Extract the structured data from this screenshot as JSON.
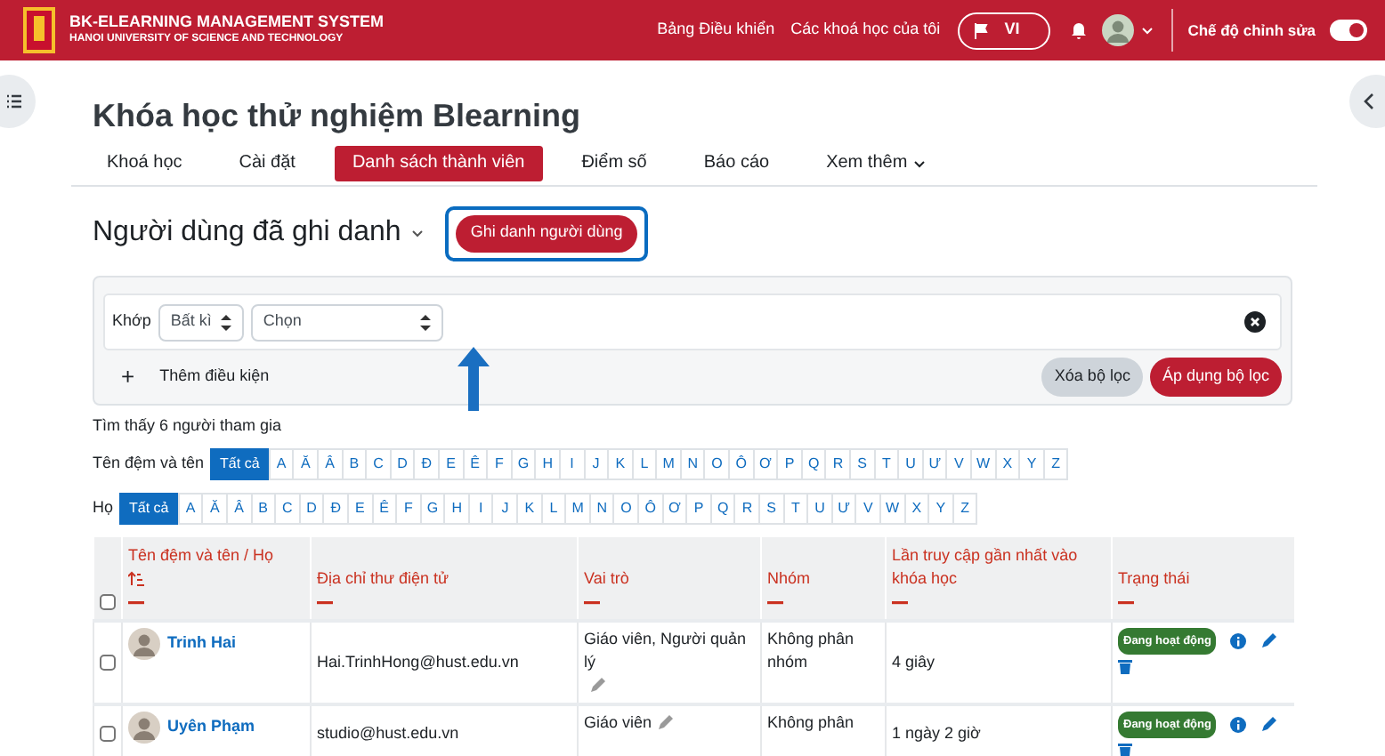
{
  "navbar": {
    "brand_title": "BK-ELEARNING MANAGEMENT SYSTEM",
    "brand_subtitle": "HANOI UNIVERSITY OF SCIENCE AND TECHNOLOGY",
    "links": [
      "Bảng Điều khiển",
      "Các khoá học của tôi"
    ],
    "language": "VI",
    "edit_mode_label": "Chế độ chỉnh sửa",
    "edit_mode_on": true
  },
  "course_title": "Khóa học thử nghiệm Blearning",
  "tabs": [
    {
      "label": "Khoá học",
      "selected": false,
      "has_menu": false
    },
    {
      "label": "Cài đặt",
      "selected": false,
      "has_menu": false
    },
    {
      "label": "Danh sách thành viên",
      "selected": true,
      "has_menu": false
    },
    {
      "label": "Điểm số",
      "selected": false,
      "has_menu": false
    },
    {
      "label": "Báo cáo",
      "selected": false,
      "has_menu": false
    },
    {
      "label": "Xem thêm",
      "selected": false,
      "has_menu": true
    }
  ],
  "page_heading": "Người dùng đã ghi danh",
  "enrol_button": "Ghi danh người dùng",
  "filter": {
    "match_label": "Khớp",
    "match_value": "Bất kì",
    "type_value": "Chọn",
    "add_symbol": "+",
    "add_condition": "Thêm điều kiện",
    "clear_button": "Xóa bộ lọc",
    "apply_button": "Áp dụng bộ lọc"
  },
  "result_count": "Tìm thấy 6 người tham gia",
  "initials_bars": [
    {
      "label": "Tên đệm và tên",
      "letters": [
        {
          "label": "Tất cả",
          "selected": true
        },
        {
          "label": "A",
          "selected": false
        },
        {
          "label": "Ă",
          "selected": false
        },
        {
          "label": "Â",
          "selected": false
        },
        {
          "label": "B",
          "selected": false
        },
        {
          "label": "C",
          "selected": false
        },
        {
          "label": "D",
          "selected": false
        },
        {
          "label": "Đ",
          "selected": false
        },
        {
          "label": "E",
          "selected": false
        },
        {
          "label": "Ê",
          "selected": false
        },
        {
          "label": "F",
          "selected": false
        },
        {
          "label": "G",
          "selected": false
        },
        {
          "label": "H",
          "selected": false
        },
        {
          "label": "I",
          "selected": false
        },
        {
          "label": "J",
          "selected": false
        },
        {
          "label": "K",
          "selected": false
        },
        {
          "label": "L",
          "selected": false
        },
        {
          "label": "M",
          "selected": false
        },
        {
          "label": "N",
          "selected": false
        },
        {
          "label": "O",
          "selected": false
        },
        {
          "label": "Ô",
          "selected": false
        },
        {
          "label": "Ơ",
          "selected": false
        },
        {
          "label": "P",
          "selected": false
        },
        {
          "label": "Q",
          "selected": false
        },
        {
          "label": "R",
          "selected": false
        },
        {
          "label": "S",
          "selected": false
        },
        {
          "label": "T",
          "selected": false
        },
        {
          "label": "U",
          "selected": false
        },
        {
          "label": "Ư",
          "selected": false
        },
        {
          "label": "V",
          "selected": false
        },
        {
          "label": "W",
          "selected": false
        },
        {
          "label": "X",
          "selected": false
        },
        {
          "label": "Y",
          "selected": false
        },
        {
          "label": "Z",
          "selected": false
        }
      ]
    },
    {
      "label": "Họ",
      "letters": [
        {
          "label": "Tất cả",
          "selected": true
        },
        {
          "label": "A",
          "selected": false
        },
        {
          "label": "Ă",
          "selected": false
        },
        {
          "label": "Â",
          "selected": false
        },
        {
          "label": "B",
          "selected": false
        },
        {
          "label": "C",
          "selected": false
        },
        {
          "label": "D",
          "selected": false
        },
        {
          "label": "Đ",
          "selected": false
        },
        {
          "label": "E",
          "selected": false
        },
        {
          "label": "Ê",
          "selected": false
        },
        {
          "label": "F",
          "selected": false
        },
        {
          "label": "G",
          "selected": false
        },
        {
          "label": "H",
          "selected": false
        },
        {
          "label": "I",
          "selected": false
        },
        {
          "label": "J",
          "selected": false
        },
        {
          "label": "K",
          "selected": false
        },
        {
          "label": "L",
          "selected": false
        },
        {
          "label": "M",
          "selected": false
        },
        {
          "label": "N",
          "selected": false
        },
        {
          "label": "O",
          "selected": false
        },
        {
          "label": "Ô",
          "selected": false
        },
        {
          "label": "Ơ",
          "selected": false
        },
        {
          "label": "P",
          "selected": false
        },
        {
          "label": "Q",
          "selected": false
        },
        {
          "label": "R",
          "selected": false
        },
        {
          "label": "S",
          "selected": false
        },
        {
          "label": "T",
          "selected": false
        },
        {
          "label": "U",
          "selected": false
        },
        {
          "label": "Ư",
          "selected": false
        },
        {
          "label": "V",
          "selected": false
        },
        {
          "label": "W",
          "selected": false
        },
        {
          "label": "X",
          "selected": false
        },
        {
          "label": "Y",
          "selected": false
        },
        {
          "label": "Z",
          "selected": false
        }
      ]
    }
  ],
  "table": {
    "select_all_checked": false,
    "columns": [
      {
        "label": "Tên đệm và tên / Họ",
        "sorted": true
      },
      {
        "label": "Địa chỉ thư điện tử",
        "sorted": false
      },
      {
        "label": "Vai trò",
        "sorted": false
      },
      {
        "label": "Nhóm",
        "sorted": false
      },
      {
        "label": "Lần truy cập gần nhất vào khóa học",
        "sorted": false
      },
      {
        "label": "Trạng thái",
        "sorted": false
      }
    ],
    "rows": [
      {
        "checked": false,
        "name": "Trinh Hai",
        "email": "Hai.TrinhHong@hust.edu.vn",
        "roles": "Giáo viên, Người quản lý",
        "group": "Không phân nhóm",
        "last_access": "4 giây",
        "status": "Đang hoạt động"
      },
      {
        "checked": false,
        "name": "Uyên Phạm",
        "email": "studio@hust.edu.vn",
        "roles": "Giáo viên",
        "group": "Không phân",
        "last_access": "1 ngày 2 giờ",
        "status": "Đang hoạt động"
      }
    ]
  }
}
